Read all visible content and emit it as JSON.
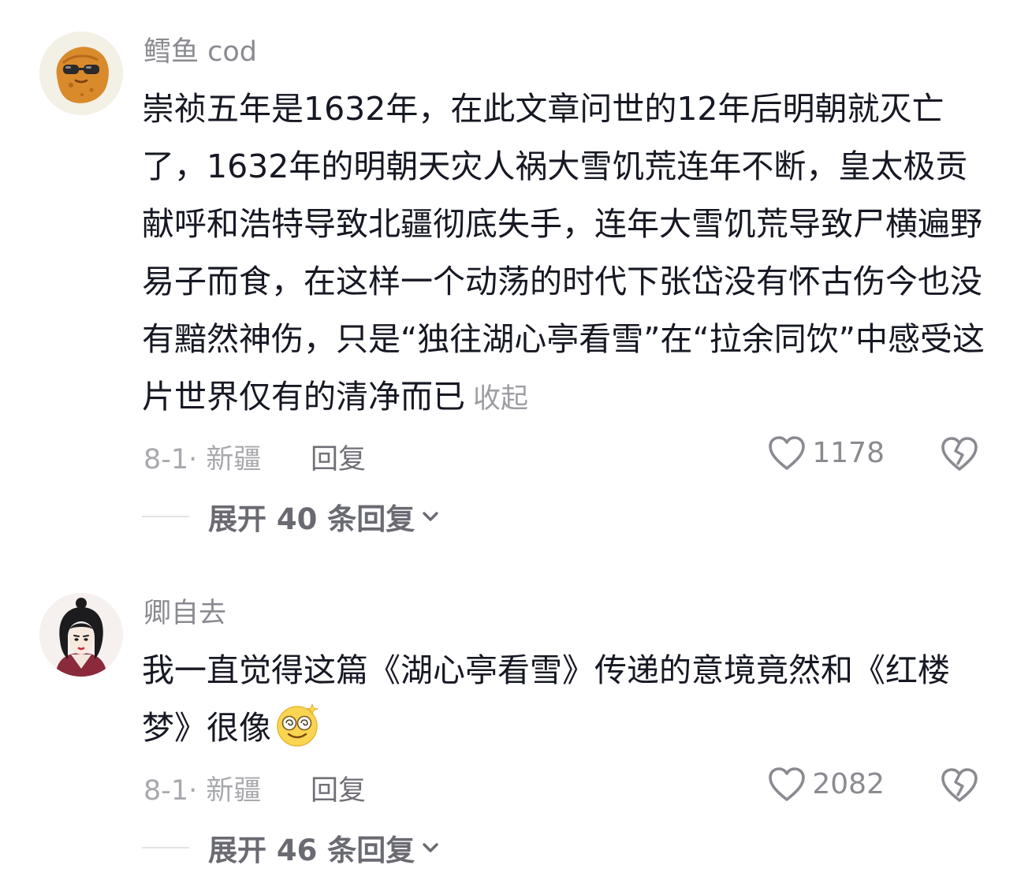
{
  "comments": [
    {
      "username": "鳕鱼 cod",
      "avatar_icon": "sunglasses-nugget-avatar",
      "text": "崇祯五年是1632年，在此文章问世的12年后明朝就灭亡了，1632年的明朝天灾人祸大雪饥荒连年不断，皇太极贡献呼和浩特导致北疆彻底失手，连年大雪饥荒导致尸横遍野易子而食，在这样一个动荡的时代下张岱没有怀古伤今也没有黯然神伤，只是“独往湖心亭看雪”在“拉余同饮”中感受这片世界仅有的清净而已",
      "collapse_label": "收起",
      "date_location": "8-1· 新疆",
      "reply_label": "回复",
      "like_count": "1178",
      "expand_label": "展开 40 条回复"
    },
    {
      "username": "卿自去",
      "avatar_icon": "ink-portrait-avatar",
      "text": "我一直觉得这篇《湖心亭看雪》传递的意境竟然和《红楼梦》很像",
      "emoji_icon": "dizzy-smile-emoji-icon",
      "date_location": "8-1· 新疆",
      "reply_label": "回复",
      "like_count": "2082",
      "expand_label": "展开 46 条回复"
    }
  ],
  "colors": {
    "primary_text": "#161823",
    "username": "#8a8b91",
    "meta": "#a8a9ae",
    "icon_gray": "#8a8b91"
  }
}
